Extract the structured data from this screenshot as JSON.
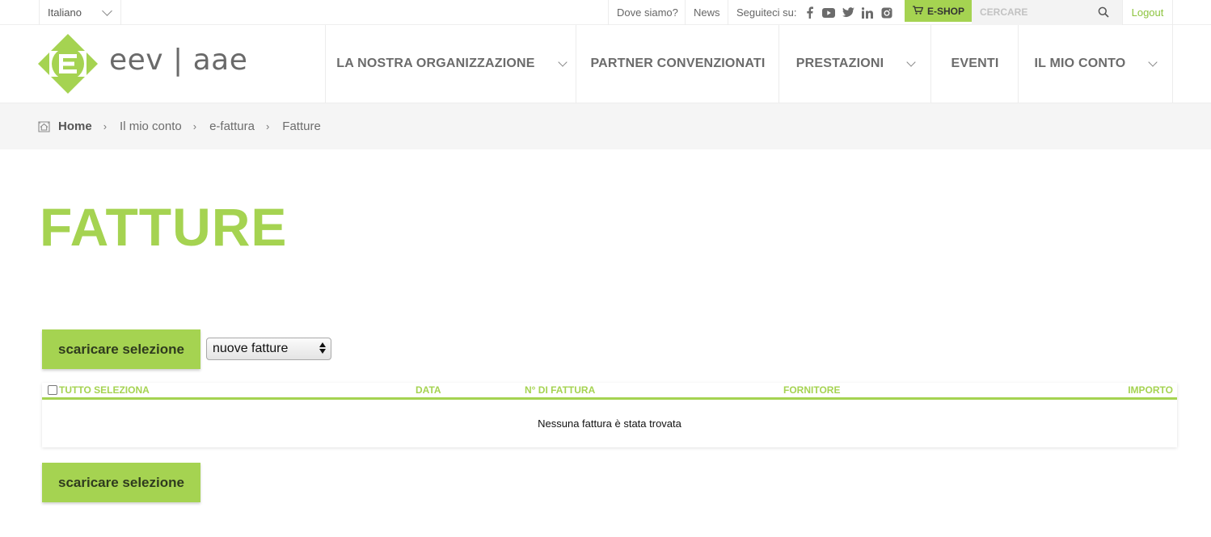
{
  "topbar": {
    "language": "Italiano",
    "where": "Dove siamo?",
    "news": "News",
    "follow": "Seguiteci su:",
    "social": [
      "facebook-icon",
      "youtube-icon",
      "twitter-icon",
      "linkedin-icon",
      "instagram-icon"
    ],
    "eshop": "E-SHOP",
    "search_placeholder": "CERCARE",
    "logout": "Logout"
  },
  "header": {
    "logo_text": "eev | aae",
    "nav": [
      {
        "label": "LA NOSTRA ORGANIZZAZIONE",
        "has_dropdown": true
      },
      {
        "label": "PARTNER CONVENZIONATI",
        "has_dropdown": false
      },
      {
        "label": "PRESTAZIONI",
        "has_dropdown": true
      },
      {
        "label": "EVENTI",
        "has_dropdown": false
      },
      {
        "label": "IL MIO CONTO",
        "has_dropdown": true
      }
    ]
  },
  "breadcrumb": [
    "Home",
    "Il mio conto",
    "e-fattura",
    "Fatture"
  ],
  "page": {
    "title": "FATTURE",
    "download_label": "scaricare selezione",
    "filter_value": "nuove fatture"
  },
  "table": {
    "columns": {
      "select_all": "TUTTO SELEZIONA",
      "date": "DATA",
      "number": "N° DI FATTURA",
      "supplier": "FORNITORE",
      "amount": "IMPORTO"
    },
    "empty_message": "Nessuna fattura è stata trovata"
  },
  "colors": {
    "brand_green": "#a5d351",
    "link_green": "#8dc43e",
    "text_gray": "#6b6b6b"
  }
}
